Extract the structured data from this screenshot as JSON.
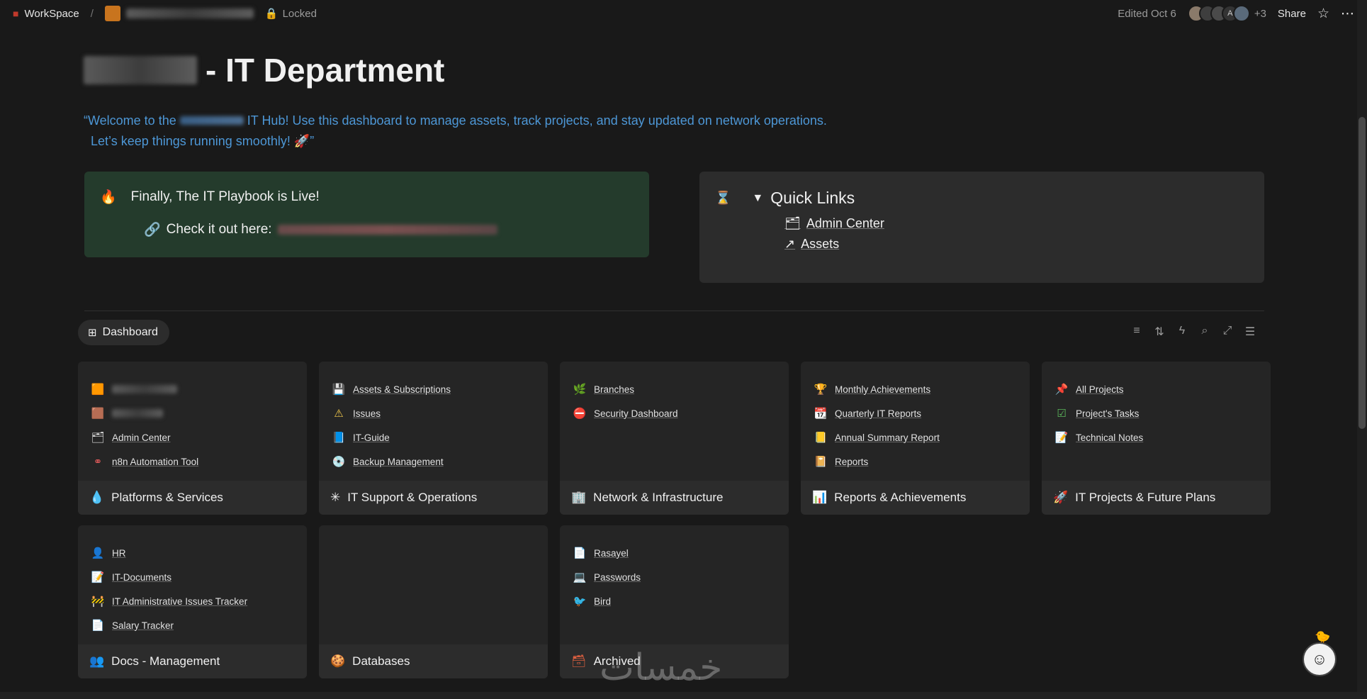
{
  "topbar": {
    "workspace_label": "WorkSpace",
    "locked_label": "Locked",
    "edited_label": "Edited Oct 6",
    "avatar_letter": "A",
    "extra_count": "+3",
    "share_label": "Share"
  },
  "page": {
    "title_suffix": "- IT Department",
    "welcome_part1": "“Welcome to the",
    "welcome_part2": "IT Hub! Use this dashboard to manage assets, track projects, and stay updated on network operations.",
    "welcome_line2": "Let’s keep things running smoothly! 🚀”"
  },
  "callout_green": {
    "icon": "🔥",
    "headline": "Finally, The IT Playbook is Live!",
    "link_icon": "🔗",
    "link_prefix": "Check it out here:"
  },
  "quick_links": {
    "icon": "⌛",
    "heading": "Quick Links",
    "items": [
      {
        "icon": "🗂",
        "label": "Admin Center"
      },
      {
        "icon": "↗",
        "label": "Assets"
      }
    ]
  },
  "dashboard": {
    "view_label": "Dashboard"
  },
  "cards": [
    {
      "title": "Platforms & Services",
      "icon": "💧",
      "items": [
        {
          "icon": "🟧",
          "label": ""
        },
        {
          "icon": "🟫",
          "label": ""
        },
        {
          "icon": "🗂",
          "label": "Admin Center"
        },
        {
          "icon": "⚭",
          "label": "n8n Automation Tool"
        }
      ]
    },
    {
      "title": "IT Support & Operations",
      "icon": "✳",
      "items": [
        {
          "icon": "💾",
          "label": "Assets & Subscriptions"
        },
        {
          "icon": "⚠",
          "label": "Issues"
        },
        {
          "icon": "📘",
          "label": "IT-Guide"
        },
        {
          "icon": "💿",
          "label": "Backup Management"
        }
      ]
    },
    {
      "title": "Network & Infrastructure",
      "icon": "🏢",
      "items": [
        {
          "icon": "🌿",
          "label": "Branches"
        },
        {
          "icon": "⛔",
          "label": "Security Dashboard"
        }
      ]
    },
    {
      "title": "Reports & Achievements",
      "icon": "📊",
      "items": [
        {
          "icon": "🏆",
          "label": "Monthly Achievements"
        },
        {
          "icon": "📆",
          "label": "Quarterly IT Reports"
        },
        {
          "icon": "📒",
          "label": "Annual Summary Report"
        },
        {
          "icon": "📔",
          "label": "Reports"
        }
      ]
    },
    {
      "title": "IT Projects & Future Plans",
      "icon": "🚀",
      "items": [
        {
          "icon": "📌",
          "label": "All Projects"
        },
        {
          "icon": "☑",
          "label": "Project's Tasks"
        },
        {
          "icon": "📝",
          "label": "Technical Notes"
        }
      ]
    },
    {
      "title": "Docs - Management",
      "icon": "👥",
      "items": [
        {
          "icon": "👤",
          "label": "HR"
        },
        {
          "icon": "📝",
          "label": "IT-Documents"
        },
        {
          "icon": "🚧",
          "label": "IT Administrative Issues Tracker"
        },
        {
          "icon": "📄",
          "label": "Salary Tracker"
        }
      ]
    },
    {
      "title": "Databases",
      "icon": "🍪",
      "items": []
    },
    {
      "title": "Archived",
      "icon": "🗃",
      "items": [
        {
          "icon": "📄",
          "label": "Rasayel"
        },
        {
          "icon": "💻",
          "label": "Passwords"
        },
        {
          "icon": "🐦",
          "label": "Bird"
        }
      ]
    }
  ],
  "colors": {
    "background": "#191919",
    "link_blue": "#4d97d6",
    "callout_green": "#243b2c",
    "card": "#252525"
  }
}
